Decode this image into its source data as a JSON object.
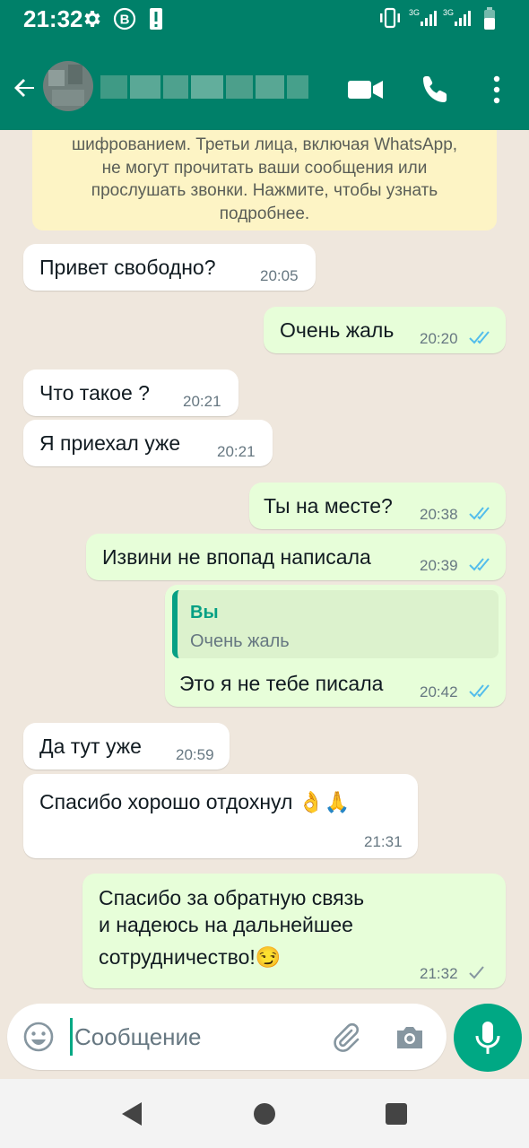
{
  "status_bar": {
    "time": "21:32",
    "network_1": "3G",
    "network_2": "3G"
  },
  "header": {
    "contact_name": "",
    "icons": [
      "back-arrow-icon",
      "video-call-icon",
      "phone-icon",
      "more-vertical-icon"
    ]
  },
  "encryption_notice": {
    "lines": [
      "шифрованием. Третьи лица, включая WhatsApp,",
      "не могут прочитать ваши сообщения или",
      "прослушать звонки. Нажмите, чтобы узнать",
      "подробнее."
    ]
  },
  "messages": [
    {
      "direction": "in",
      "text": "Привет свободно?",
      "time": "20:05"
    },
    {
      "direction": "out",
      "text": "Очень жаль",
      "time": "20:20",
      "status": "read"
    },
    {
      "direction": "in",
      "text": "Что такое ?",
      "time": "20:21"
    },
    {
      "direction": "in",
      "text": "Я приехал уже",
      "time": "20:21"
    },
    {
      "direction": "out",
      "text": "Ты на месте?",
      "time": "20:38",
      "status": "read"
    },
    {
      "direction": "out",
      "text": "Извини не впопад написала",
      "time": "20:39",
      "status": "read"
    },
    {
      "direction": "out",
      "reply_author": "Вы",
      "reply_text": "Очень жаль",
      "text": "Это я не тебе писала",
      "time": "20:42",
      "status": "read"
    },
    {
      "direction": "in",
      "text": "Да тут уже",
      "time": "20:59"
    },
    {
      "direction": "in",
      "text": "Спасибо хорошо отдохнул 👌🙏",
      "time": "21:31"
    },
    {
      "direction": "out",
      "lines": [
        "Спасибо за обратную связь",
        "и надеюсь на дальнейшее",
        "сотрудничество!😏"
      ],
      "time": "21:32",
      "status": "sent"
    }
  ],
  "composer": {
    "placeholder": "Сообщение"
  },
  "colors": {
    "header": "#008069",
    "accent": "#00a884",
    "incoming_bubble": "#ffffff",
    "outgoing_bubble": "#e7fed9",
    "read_ticks": "#53bdeb",
    "chat_bg": "#efe7dd"
  }
}
